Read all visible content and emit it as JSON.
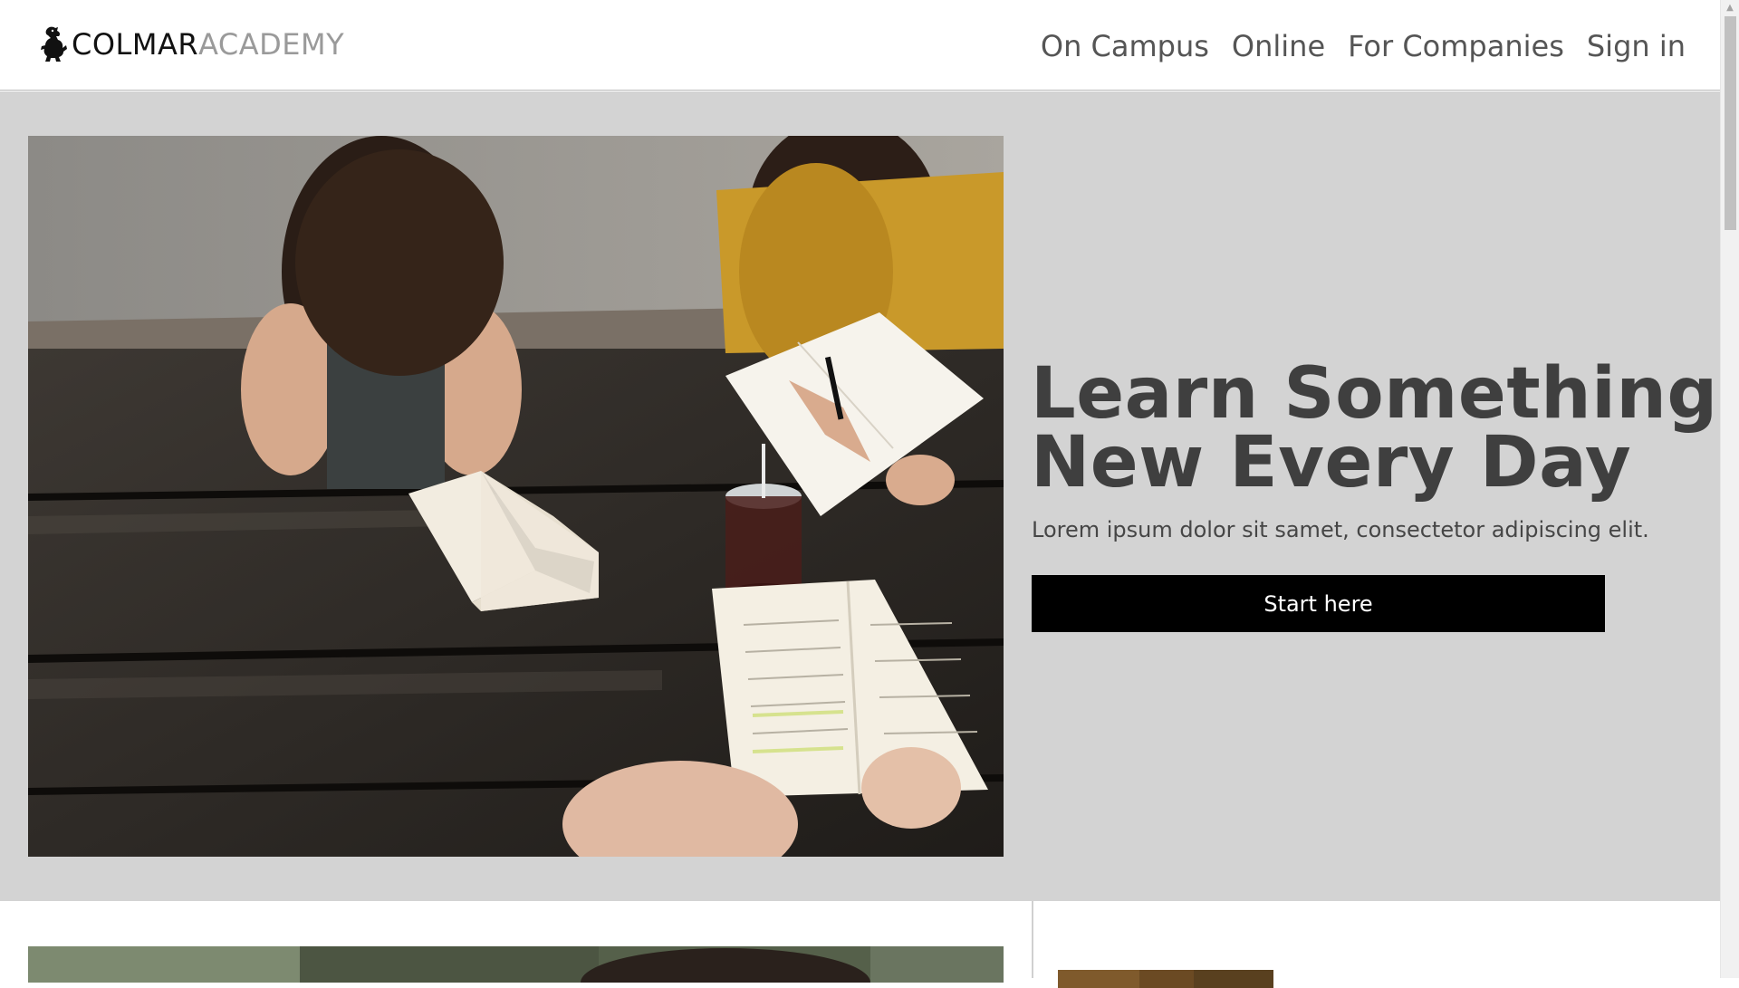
{
  "header": {
    "logo": {
      "icon": "lion-rampant-icon",
      "text_primary": "COLMAR",
      "text_secondary": "ACADEMY"
    },
    "nav": [
      {
        "label": "On Campus"
      },
      {
        "label": "Online"
      },
      {
        "label": "For Companies"
      },
      {
        "label": "Sign in"
      }
    ]
  },
  "hero": {
    "image": "students-reading-at-wooden-table-photo",
    "title_line1": "Learn Something",
    "title_line2": "New Every Day",
    "subtitle": "Lorem ipsum dolor sit samet, consectetor adipiscing elit.",
    "cta_label": "Start here"
  },
  "below_fold": {
    "images": [
      "student-portrait-photo",
      "outdoor-autumn-photo"
    ]
  },
  "colors": {
    "hero_background": "#d3d3d3",
    "cta_background": "#000000",
    "cta_text": "#ffffff",
    "title_text": "#3f3f3f",
    "nav_text": "#555555",
    "logo_secondary": "#9a9a9a"
  }
}
